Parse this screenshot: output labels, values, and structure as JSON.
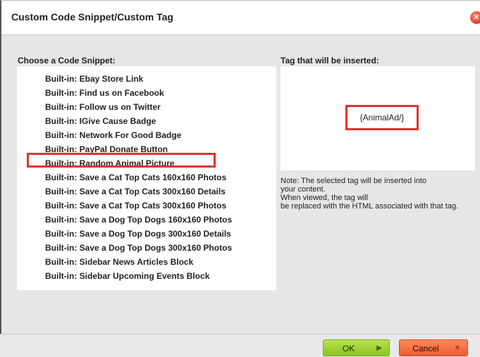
{
  "dialog": {
    "title": "Custom Code Snippet/Custom Tag"
  },
  "left_panel": {
    "label": "Choose a Code Snippet:",
    "items": [
      "Built-in: Ebay Store Link",
      "Built-in: Find us on Facebook",
      "Built-in: Follow us on Twitter",
      "Built-in: IGive Cause Badge",
      "Built-in: Network For Good Badge",
      "Built-in: PayPal Donate Button",
      "Built-in: Random Animal Picture",
      "Built-in: Save a Cat Top Cats 160x160 Photos",
      "Built-in: Save a Cat Top Cats 300x160 Details",
      "Built-in: Save a Cat Top Cats 300x160 Photos",
      "Built-in: Save a Dog Top Dogs 160x160 Photos",
      "Built-in: Save a Dog Top Dogs 300x160 Details",
      "Built-in: Save a Dog Top Dogs 300x160 Photos",
      "Built-in: Sidebar News Articles Block",
      "Built-in: Sidebar Upcoming Events Block"
    ],
    "selected_index": 6
  },
  "right_panel": {
    "label": "Tag that will be inserted:",
    "tag_value": "{AnimalAd/}",
    "note_lines": [
      "Note: The selected tag will be inserted into",
      "your content.",
      "When viewed, the tag will",
      "be replaced with the HTML associated with that tag."
    ]
  },
  "buttons": {
    "ok_label": "OK",
    "cancel_label": "Cancel"
  },
  "icons": {
    "close": "close-icon",
    "ok_arrow": "arrow-right-icon",
    "cancel_x": "x-icon"
  },
  "colors": {
    "highlight": "#e0342e",
    "ok": "#8cc51f",
    "cancel": "#ee5a2e"
  }
}
